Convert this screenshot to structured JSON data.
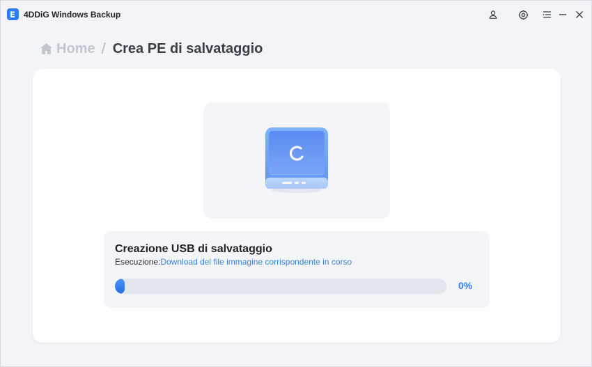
{
  "app": {
    "title": "4DDiG Windows Backup",
    "accent": "#2f7bf5"
  },
  "titlebar": {
    "icons": [
      "user-icon",
      "settings-icon",
      "menu-icon",
      "minimize-icon",
      "close-icon"
    ]
  },
  "breadcrumb": {
    "home_label": "Home",
    "separator": "/",
    "current": "Crea PE di salvataggio"
  },
  "status": {
    "title": "Creazione USB di salvataggio",
    "label": "Esecuzione:",
    "detail": "Download del file immagine corrispondente in corso",
    "progress_text": "0%",
    "progress_value": 0
  }
}
